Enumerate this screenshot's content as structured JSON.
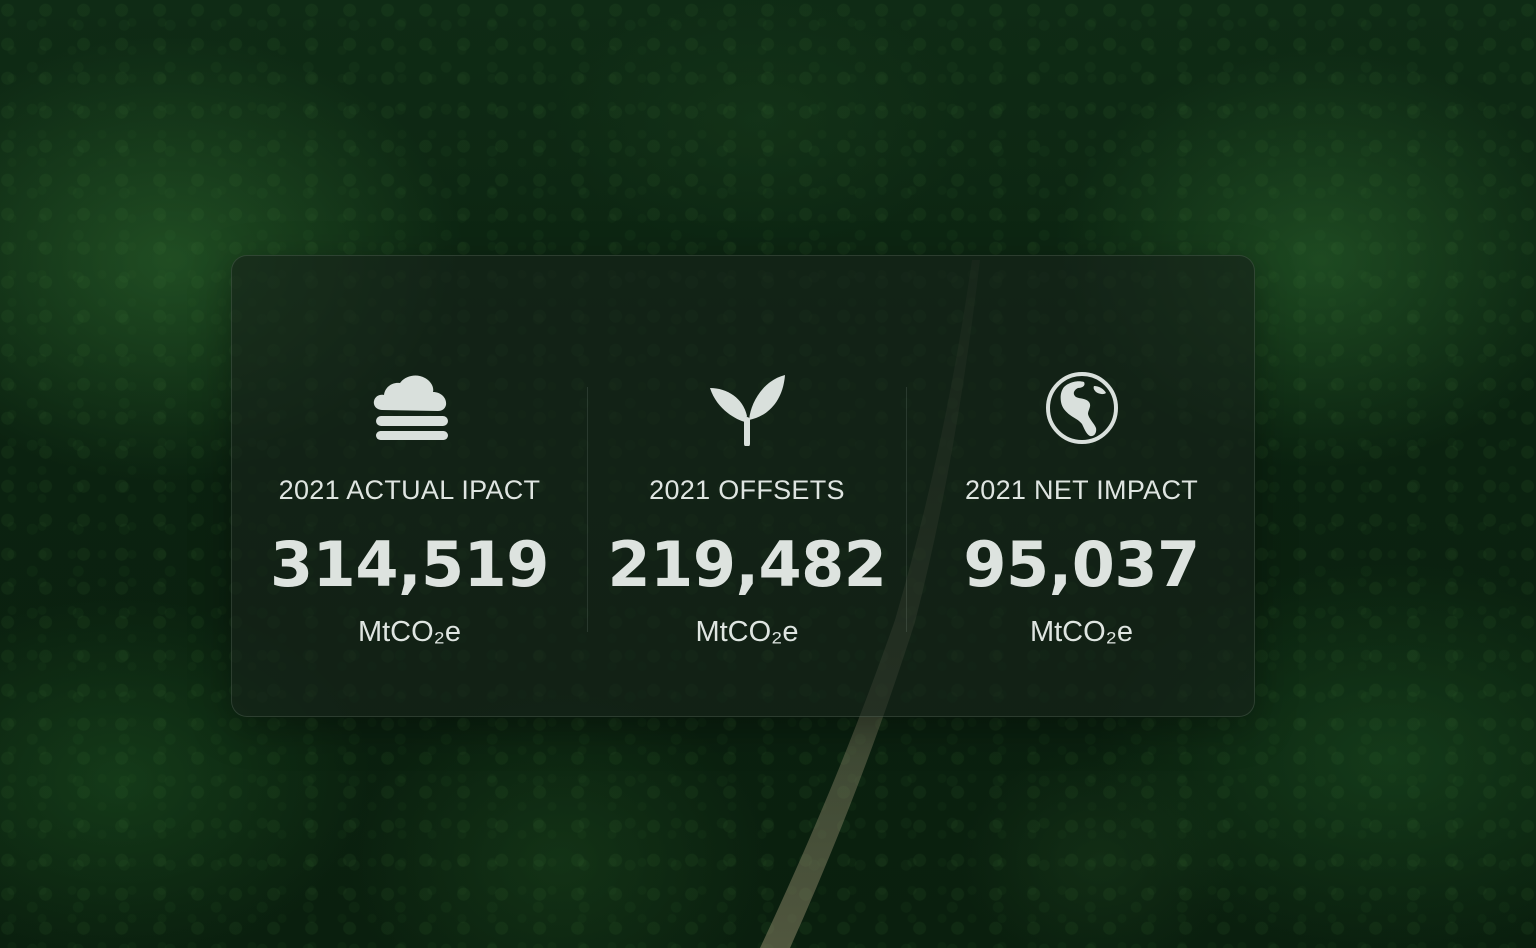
{
  "stats": [
    {
      "icon": "cloud-icon",
      "label": "2021 ACTUAL  IPACT",
      "value": "314,519",
      "unit": "MtCO₂e"
    },
    {
      "icon": "sprout-icon",
      "label": "2021 OFFSETS",
      "value": "219,482",
      "unit": "MtCO₂e"
    },
    {
      "icon": "globe-icon",
      "label": "2021 NET IMPACT",
      "value": "95,037",
      "unit": "MtCO₂e"
    }
  ],
  "colors": {
    "text": "#dfe5e1",
    "panel": "#16221a",
    "icon": "#d9e0dc"
  }
}
